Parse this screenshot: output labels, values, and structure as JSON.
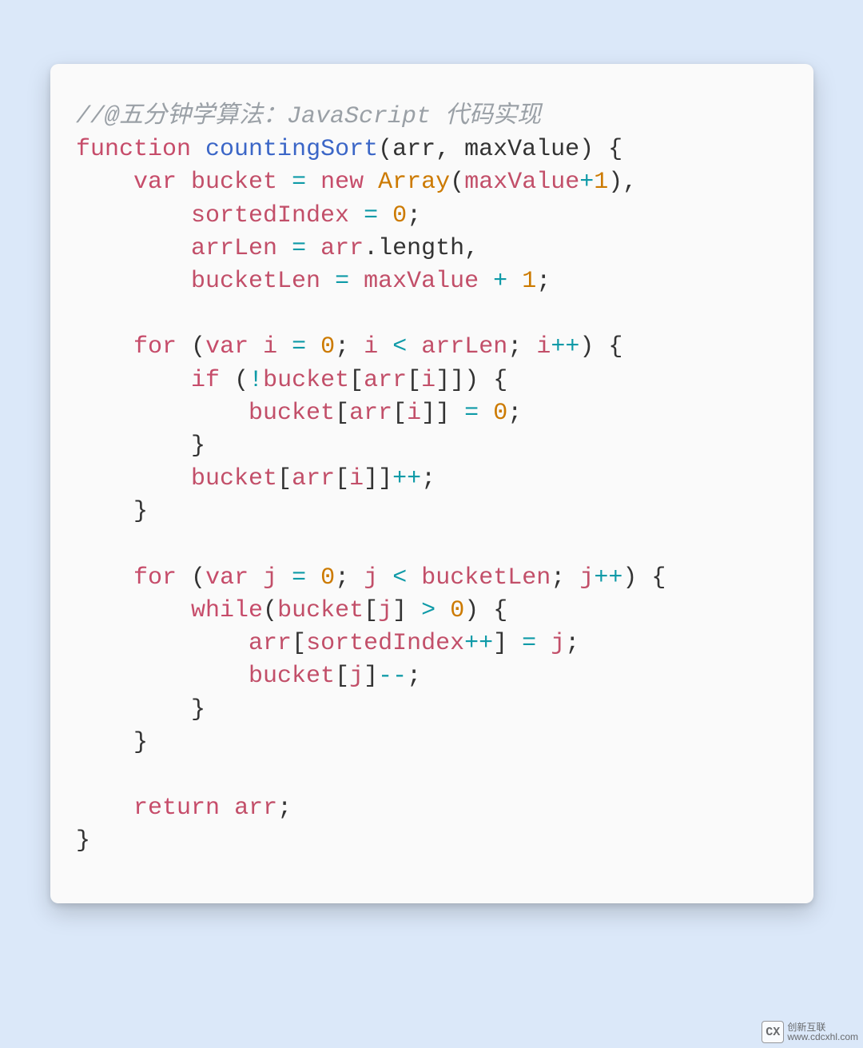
{
  "code": {
    "comment": "//@五分钟学算法：JavaScript 代码实现",
    "kw_function": "function",
    "func_name": "countingSort",
    "param_arr": "arr",
    "param_maxValue": "maxValue",
    "kw_var": "var",
    "id_bucket": "bucket",
    "kw_new": "new",
    "class_Array": "Array",
    "num_1": "1",
    "id_sortedIndex": "sortedIndex",
    "num_0": "0",
    "id_arrLen": "arrLen",
    "id_arr": "arr",
    "prop_length": "length",
    "id_bucketLen": "bucketLen",
    "id_maxValue": "maxValue",
    "kw_for": "for",
    "id_i": "i",
    "kw_if": "if",
    "kw_while": "while",
    "id_j": "j",
    "kw_return": "return"
  },
  "watermark": {
    "logo": "CX",
    "line1": "创新互联",
    "line2": "www.cdcxhl.com"
  }
}
